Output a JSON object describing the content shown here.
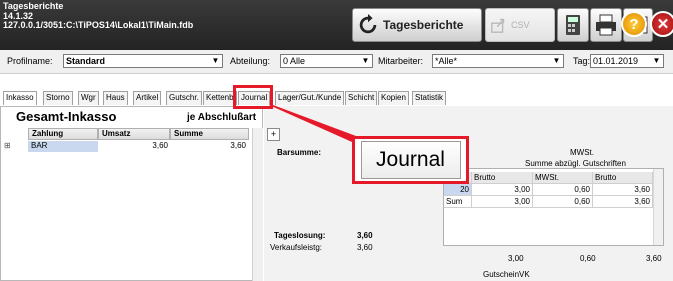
{
  "titlebar": {
    "line1": "Tagesberichte",
    "line2": "14.1.32",
    "line3": "127.0.0.1/3051:C:\\TiPOS14\\Lokal1\\TiMain.fdb"
  },
  "toolbar": {
    "report_label": "Tagesberichte",
    "export_label": "CSV"
  },
  "filters": {
    "profil_label": "Profilname:",
    "profil_value": "Standard",
    "abteilung_label": "Abteilung:",
    "abteilung_value": "0 Alle",
    "mitarbeiter_label": "Mitarbeiter:",
    "mitarbeiter_value": "*Alle*",
    "tag_label": "Tag:",
    "tag_value": "01.01.2019"
  },
  "tabs": [
    "Inkasso",
    "Storno",
    "Wgr",
    "Haus",
    "Artikel",
    "Gutschr.",
    "Kettenb",
    "Journal",
    "Lager/Gut./Kunde",
    "Schicht",
    "Kopien",
    "Statistik"
  ],
  "left": {
    "title": "Gesamt-Inkasso",
    "subtitle": "je Abschlußart",
    "columns": [
      "Zahlung",
      "Umsatz",
      "Summe"
    ],
    "row": {
      "expander": "⊞",
      "zahlung": "BAR",
      "umsatz": "3,60",
      "summe": "3,60"
    }
  },
  "right": {
    "plus": "+",
    "barsumme_label": "Barsumme:",
    "mwst_title": "MWSt.",
    "mwst_subtitle": "Summe abzügl. Gutschriften",
    "grid_headers": [
      "",
      "Brutto",
      "MWSt.",
      "Brutto"
    ],
    "grid_rows": [
      [
        "20",
        "3,00",
        "0,60",
        "3,60"
      ],
      [
        "Sum",
        "3,00",
        "0,60",
        "3,60"
      ]
    ],
    "tageslosung_label": "Tageslosung:",
    "tageslosung_value": "3,60",
    "verkaufsleistg_label": "Verkaufsleistg:",
    "verkaufsleistg_value": "3,60",
    "totals": [
      "3,00",
      "0,60",
      "3,60"
    ],
    "gutschein_label": "GutscheinVK"
  },
  "callout": {
    "label": "Journal"
  },
  "colors": {
    "highlight": "#e6192a",
    "selected_cell": "#c9d8ee"
  }
}
